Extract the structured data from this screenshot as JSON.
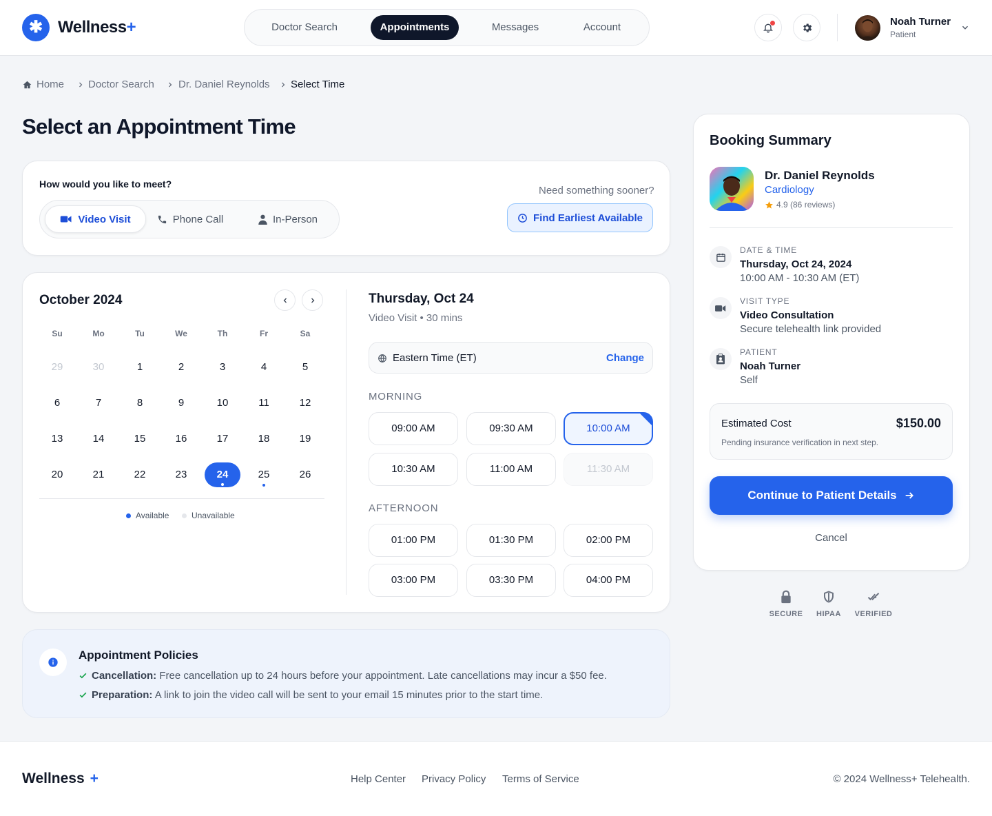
{
  "brand": {
    "name": "Wellness",
    "plus": "+"
  },
  "nav": {
    "items": [
      "Doctor Search",
      "Appointments",
      "Messages",
      "Account"
    ],
    "active": "Appointments"
  },
  "user": {
    "name": "Noah Turner",
    "role": "Patient"
  },
  "breadcrumb": [
    "Home",
    "Doctor Search",
    "Dr. Daniel Reynolds",
    "Select Time"
  ],
  "page_title": "Select an Appointment Time",
  "meet": {
    "question": "How would you like to meet?",
    "options": [
      "Video Visit",
      "Phone Call",
      "In-Person"
    ],
    "selected": "Video Visit",
    "sooner_text": "Need something sooner?",
    "earliest_label": "Find Earliest Available"
  },
  "calendar": {
    "month": "October 2024",
    "weekdays": [
      "Su",
      "Mo",
      "Tu",
      "We",
      "Th",
      "Fr",
      "Sa"
    ],
    "weeks": [
      [
        "29",
        "30",
        "1",
        "2",
        "3",
        "4",
        "5"
      ],
      [
        "6",
        "7",
        "8",
        "9",
        "10",
        "11",
        "12"
      ],
      [
        "13",
        "14",
        "15",
        "16",
        "17",
        "18",
        "19"
      ],
      [
        "20",
        "21",
        "22",
        "23",
        "24",
        "25",
        "26"
      ]
    ],
    "muted_days": [
      "29",
      "30"
    ],
    "selected_day": "24",
    "available_dot_days": [
      "24",
      "25"
    ],
    "legend": {
      "available": "Available",
      "unavailable": "Unavailable"
    }
  },
  "slots": {
    "date": "Thursday, Oct 24",
    "subtitle": "Video Visit • 30 mins",
    "timezone": "Eastern Time (ET)",
    "change_label": "Change",
    "morning_label": "MORNING",
    "morning": [
      "09:00 AM",
      "09:30 AM",
      "10:00 AM",
      "10:30 AM",
      "11:00 AM",
      "11:30 AM"
    ],
    "afternoon_label": "AFTERNOON",
    "afternoon": [
      "01:00 PM",
      "01:30 PM",
      "02:00 PM",
      "03:00 PM",
      "03:30 PM",
      "04:00 PM"
    ],
    "selected": "10:00 AM",
    "unavailable": [
      "11:30 AM"
    ]
  },
  "policies": {
    "title": "Appointment Policies",
    "items": [
      {
        "label": "Cancellation:",
        "text": "Free cancellation up to 24 hours before your appointment. Late cancellations may incur a $50 fee."
      },
      {
        "label": "Preparation:",
        "text": "A link to join the video call will be sent to your email 15 minutes prior to the start time."
      }
    ]
  },
  "summary": {
    "title": "Booking Summary",
    "doctor": {
      "name": "Dr. Daniel Reynolds",
      "specialty": "Cardiology",
      "rating": "4.9 (86 reviews)"
    },
    "datetime": {
      "label": "DATE & TIME",
      "main": "Thursday, Oct 24, 2024",
      "sub": "10:00 AM - 10:30 AM (ET)"
    },
    "visit": {
      "label": "VISIT TYPE",
      "main": "Video Consultation",
      "sub": "Secure telehealth link provided"
    },
    "patient": {
      "label": "PATIENT",
      "main": "Noah Turner",
      "sub": "Self"
    },
    "cost": {
      "label": "Estimated Cost",
      "value": "$150.00",
      "note": "Pending insurance verification in next step."
    },
    "cta_label": "Continue to Patient Details",
    "cancel_label": "Cancel"
  },
  "trust": [
    "SECURE",
    "HIPAA",
    "VERIFIED"
  ],
  "footer": {
    "brand": "Wellness",
    "plus": "+",
    "links": [
      "Help Center",
      "Privacy Policy",
      "Terms of Service"
    ],
    "copyright": "© 2024 Wellness+ Telehealth."
  },
  "colors": {
    "accent": "#2563eb",
    "dark": "#0f172a",
    "notification": "#ef4444",
    "star": "#f59e0b"
  }
}
